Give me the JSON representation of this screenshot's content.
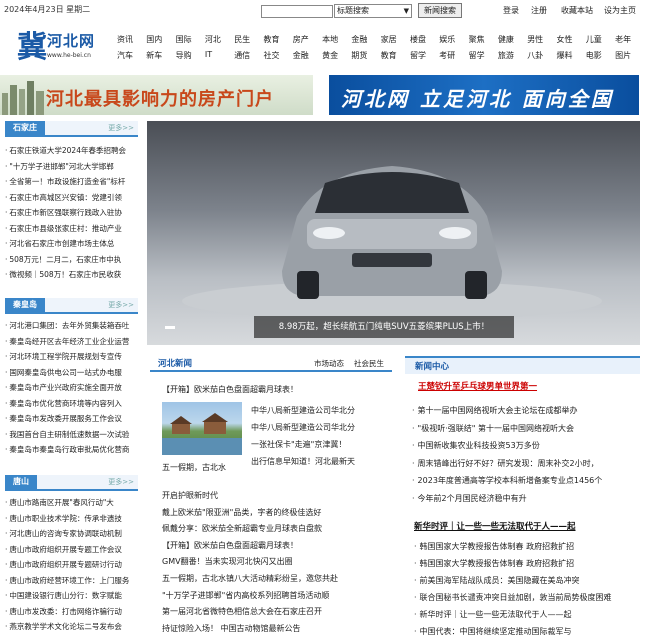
{
  "topbar": {
    "date": "2024年4月23日 星期二",
    "search_placeholder": "",
    "search_type": "标题搜索",
    "search_button": "新闻搜索",
    "links": [
      "登录",
      "注册",
      "收藏本站",
      "设为主页"
    ]
  },
  "logo": {
    "mark": "冀",
    "name": "河北网",
    "url": "www.he-bei.cn"
  },
  "nav_rows": [
    [
      "资讯",
      "国内",
      "国际",
      "河北",
      "民生",
      "教育",
      "房产",
      "本地",
      "金融",
      "家居",
      "楼盘",
      "娱乐",
      "聚焦",
      "健康",
      "男性",
      "女性",
      "儿童",
      "老年"
    ],
    [
      "汽车",
      "新车",
      "导购",
      "IT",
      "通信",
      "社交",
      "金融",
      "黄金",
      "期货",
      "教育",
      "留学",
      "考研",
      "留学",
      "旅游",
      "八卦",
      "爆料",
      "电影",
      "图片"
    ]
  ],
  "banners": {
    "left": "河北最具影响力的房产门户",
    "right": "河北网 立足河北 面向全国"
  },
  "sections": [
    {
      "tab": "石家庄",
      "more": "更多>>",
      "items": [
        "石家庄铁道大学2024年春季招聘会",
        "\"十万学子进邯郸\"河北大学邯郸",
        "全省第一！市政设施打造金省\"标杆",
        "石家庄市高城区兴安镇：党建引领",
        "石家庄市新区强联察行践政入驻协",
        "石家庄市县级张家庄村：推动产业",
        "河北省石家庄市创建市场主体总",
        "508万元！二月二，石家庄市中执",
        "微视频｜508万！石家庄市民收获"
      ]
    },
    {
      "tab": "秦皇岛",
      "more": "更多>>",
      "items": [
        "河北港口集团：去年外贸集装箱吞吐",
        "秦皇岛经开区去年经济工业企业运营",
        "河北环境工程学院开展规划专宣传",
        "国网秦皇岛供电公司一站式办电服",
        "秦皇岛市产业兴政府实施全面开放",
        "秦皇岛市优化营商环境等内容列入",
        "秦皇岛市发改委开展服务工作会议",
        "我国首台自主研制低速数据一次试验",
        "秦皇岛市秦皇岛行政审批局优化营商"
      ]
    },
    {
      "tab": "唐山",
      "more": "更多>>",
      "items": [
        "唐山市路南区开展\"春风行动\"大",
        "唐山市职业技术学院：传承非遗技",
        "河北唐山的咨询专家协调联动机制",
        "唐山市政府组织开展专题工作会议",
        "唐山市政府组织开展专题研讨行动",
        "唐山市政府经营环境工作：上门服务",
        "中国建设银行唐山分行：数字赋能",
        "唐山市发改委：打击网络诈骗行动",
        "燕京教学学术文化论坛二号发布会"
      ]
    }
  ],
  "slide": {
    "caption": "8.98万起，超长续航五门纯电SUV五菱缤果PLUS上市！"
  },
  "mid_news": {
    "title": "河北新闻",
    "tabs": [
      "市场动态",
      "社会民生"
    ],
    "headline": "【开箱】欧米茄白色盘面超霸月球表！",
    "photo_caption": "五一假期，古北水",
    "photo_items": [
      "中华八局新型建造公司华北分",
      "中华八局新型建造公司华北分",
      "一张社保卡\"走遍\"京津冀！",
      "出行信息早知道！河北最新天"
    ],
    "items": [
      "开启护眼新时代",
      "戴上欧米茄\"限亚洲\"品类，字者的终极佳选好",
      "佩戴分享：欧米茄全新超霸专业月球表白盘款",
      "【开箱】欧米茄白色盘面超霸月球表！",
      "GMV翻番！当未实现河北快闪又出圈",
      "五一假期，古北水镇八大活动精彩纷呈，邀您共赴",
      "\"十万学子进邯郸\"省内高校系列招聘首场活动顺",
      "第一届河北省微特色相信总大会在石家庄召开",
      "持证惊险入场！ 中国古动物馆最新公告"
    ]
  },
  "right_news": {
    "title": "新闻中心",
    "headline": "王楚钦升至乒乓球男单世界第一",
    "items": [
      "第十一届中国网络视听大会主论坛在成都举办",
      "\"极视听·强联结\" 第十一届中国网络视听大会",
      "中国新收集农业科技投资53万多份",
      "周末错峰出行好不好？研究发现：周末补交2小时，",
      "2023年度普通高等学校本科新增备案专业点1456个",
      "今年前2个月国民经济稳中有升"
    ],
    "headline2": "新华时评｜让一些一些无法取代于人——起",
    "items2": [
      "韩国国家大学教授报告体制春 政府招救扩招",
      "韩国国家大学教授报告体制春 政府招救扩招",
      "前美国海军陆战队成员：美国隐藏在美岛冲突",
      "联合国秘书长谴责冲突日益加剧，敦当前局势极度困难",
      "新华时评｜让一些一些无法取代于人——起",
      "中国代表：中国将继续坚定推动国际裁军与"
    ]
  },
  "colors": {
    "accent": "#3a86c9",
    "brand": "#1b5aa6",
    "hot": "#cc0000"
  }
}
